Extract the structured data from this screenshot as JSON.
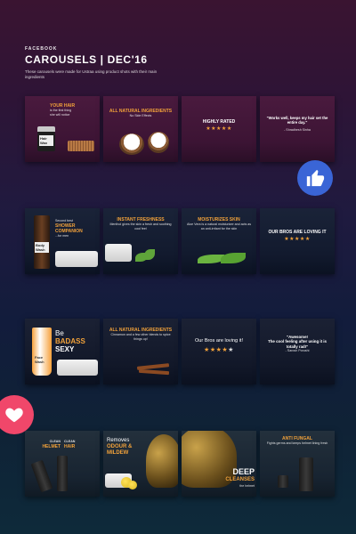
{
  "header": {
    "brand": "FACEBOOK",
    "title": "CAROUSELS | DEC'16",
    "subtitle": "These carousels were made for Ustraa using product shots with their main ingredients"
  },
  "icons": {
    "thumb": "thumbs-up-icon",
    "heart": "heart-icon"
  },
  "colors": {
    "accent": "#f2a23a",
    "thumb_bg": "#3a65d6",
    "heart_bg": "#f0476a"
  },
  "row1": {
    "c1": {
      "line1": "YOUR HAIR",
      "line2": "is the first thing",
      "line3": "she will notice",
      "jar_label": "Hair Wax"
    },
    "c2": {
      "line1": "ALL NATURAL INGREDIENTS",
      "line2": "No Side Effects"
    },
    "c3": {
      "line1": "HIGHLY RATED",
      "stars": "★★★★★"
    },
    "c4": {
      "line1": "\"Works well, keeps my hair set the entire day.\"",
      "line2": "- Shradhesh Sinha"
    }
  },
  "row2": {
    "c1": {
      "line1": "Second best",
      "line2": "SHOWER",
      "line3": "COMPANION",
      "line4": "...for men",
      "bottle_label": "Body Wash"
    },
    "c2": {
      "line1": "INSTANT FRESHNESS",
      "line2": "Menthol gives the skin a fresh and soothing cool feel"
    },
    "c3": {
      "line1": "MOISTURIZES SKIN",
      "line2": "Aloe Vera is a natural moisturizer and acts as an anti-irritant for the skin"
    },
    "c4": {
      "line1": "OUR BROS ARE LOVING IT",
      "stars": "★★★★★"
    }
  },
  "row3": {
    "c1": {
      "line1": "Be",
      "line2": "BADASS",
      "line3": "SEXY",
      "tube_label": "Face Wash"
    },
    "c2": {
      "line1": "ALL NATURAL INGREDIENTS",
      "line2": "Cinnamon and a few other blends to spice things up!"
    },
    "c3": {
      "line1": "Our Bros are loving it!",
      "stars": "★★★★★"
    },
    "c4": {
      "line1": "\"Awesome!",
      "line2": "The cool feeling after using it is totally rad!\"",
      "line3": "- Sarosh Porushi"
    }
  },
  "row4": {
    "c1": {
      "line1": "CLEAN",
      "line2": "HELMET",
      "line3": "CLEAN",
      "line4": "HAIR"
    },
    "c2": {
      "line1": "Removes",
      "line2": "ODOUR &",
      "line3": "MILDEW"
    },
    "c3": {
      "line1": "DEEP",
      "line2": "CLEANSES",
      "line3": "the helmet"
    },
    "c4": {
      "line1": "ANTI FUNGAL",
      "line2": "Fights germs and keeps helmet lining fresh"
    }
  }
}
